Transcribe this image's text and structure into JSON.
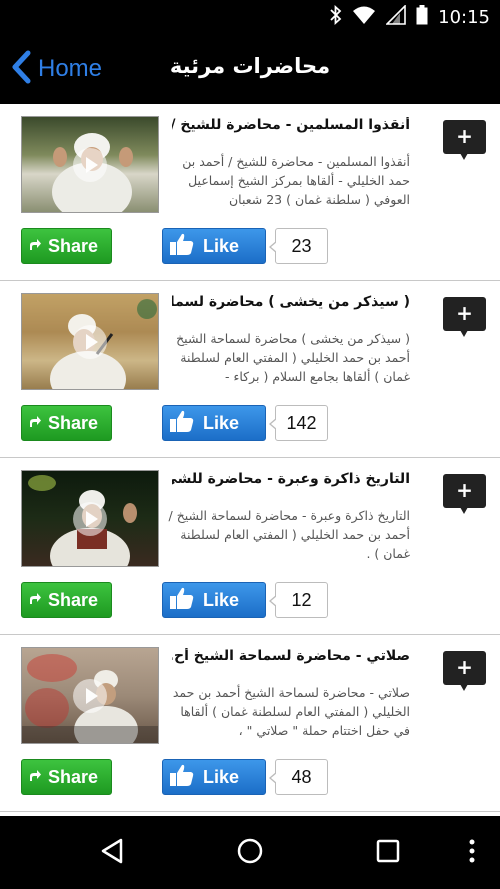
{
  "status_bar": {
    "time": "10:15",
    "icons": [
      "bluetooth-icon",
      "wifi-icon",
      "signal-icon",
      "battery-icon"
    ]
  },
  "app_bar": {
    "back_label": "Home",
    "title": "محاضرات مرئية",
    "accent": "#2f7fe6"
  },
  "videos": [
    {
      "title": "أنقذوا المسلمين - محاضرة للشيخ / ...",
      "description": "أنقذوا المسلمين - محاضرة للشيخ / أحمد بن حمد الخليلي - ألقاها بمركز الشيخ إسماعيل العوفي ( سلطنة غمان ) 23 شعبان",
      "add_label": "+",
      "share_label": "Share",
      "like_label": "Like",
      "likes": "23"
    },
    {
      "title": "( سيذكر من يخشى ) محاضرة لسما...",
      "description": "( سيذكر من يخشى ) محاضرة لسماحة الشيخ أحمد بن حمد الخليلي ( المفتي العام لسلطنة غمان ) ألقاها بجامع السلام ( بركاء -",
      "add_label": "+",
      "share_label": "Share",
      "like_label": "Like",
      "likes": "142"
    },
    {
      "title": "التاريخ ذاكرة وعبرة - محاضرة للشي...",
      "description": "التاريخ ذاكرة وعبرة - محاضرة لسماحة الشيخ / أحمد بن حمد الخليلي ( المفتي العام لسلطنة غمان ) .",
      "add_label": "+",
      "share_label": "Share",
      "like_label": "Like",
      "likes": "12"
    },
    {
      "title": "صلاتي - محاضرة لسماحة الشيخ أح...",
      "description": "صلاتي - محاضرة لسماحة الشيخ أحمد بن حمد الخليلي ( المفتي العام لسلطنة غمان ) ألقاها في حفل اختتام حملة \" صلاتي \" ،",
      "add_label": "+",
      "share_label": "Share",
      "like_label": "Like",
      "likes": "48"
    }
  ],
  "colors": {
    "share_green": "#2eb231",
    "like_blue": "#2a83dc",
    "bar_black": "#000000"
  },
  "nav_bar": {
    "icons": [
      "back-triangle-icon",
      "home-circle-icon",
      "recents-square-icon",
      "overflow-menu-icon"
    ]
  }
}
